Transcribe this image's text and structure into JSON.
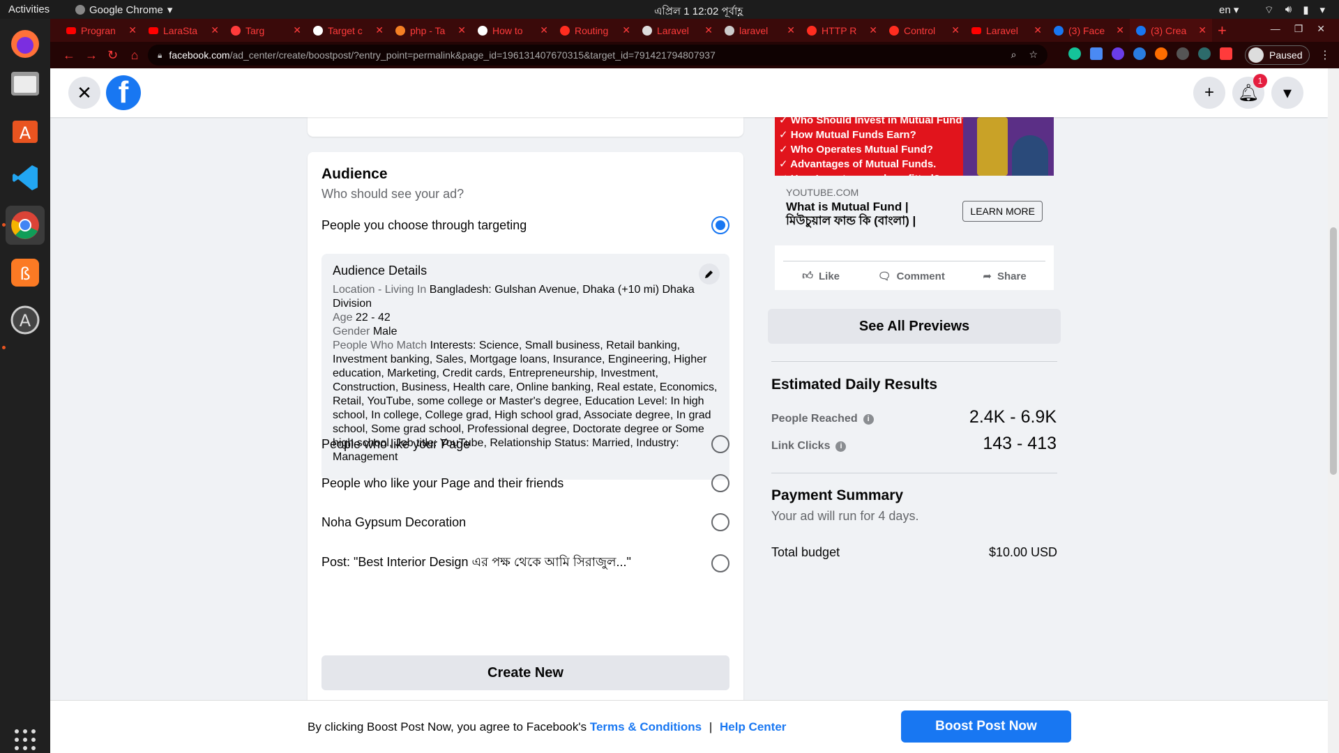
{
  "os": {
    "activities": "Activities",
    "app_name": "Google Chrome",
    "clock": "এপ্রিল 1  12:02 পূর্বাহ্ণ",
    "lang": "en"
  },
  "browser": {
    "tabs": [
      {
        "title": "Progran",
        "icon": "youtube-icon"
      },
      {
        "title": "LaraSta",
        "icon": "youtube-icon"
      },
      {
        "title": "Targ",
        "icon": "chrome-icon"
      },
      {
        "title": "Target c",
        "icon": "google-icon"
      },
      {
        "title": "php - Ta",
        "icon": "stackoverflow-icon"
      },
      {
        "title": "How to",
        "icon": "medium-icon"
      },
      {
        "title": "Routing",
        "icon": "laravel-icon"
      },
      {
        "title": "Laravel",
        "icon": "page-icon"
      },
      {
        "title": "laravel",
        "icon": "link-icon"
      },
      {
        "title": "HTTP R",
        "icon": "laravel-icon"
      },
      {
        "title": "Control",
        "icon": "laravel-icon"
      },
      {
        "title": "Laravel",
        "icon": "youtube-icon"
      },
      {
        "title": "(3) Face",
        "icon": "facebook-icon"
      },
      {
        "title": "(3) Crea",
        "icon": "facebook-icon"
      }
    ],
    "url_host": "facebook.com",
    "url_path": "/ad_center/create/boostpost/?entry_point=permalink&page_id=196131407670315&target_id=791421794807937",
    "profile_status": "Paused"
  },
  "header": {
    "notification_count": "1"
  },
  "audience": {
    "title": "Audience",
    "subtitle": "Who should see your ad?",
    "option_targeting": "People you choose through targeting",
    "details_title": "Audience Details",
    "location_label": "Location - Living In",
    "location_value": "Bangladesh: Gulshan Avenue, Dhaka (+10 mi) Dhaka Division",
    "age_label": "Age",
    "age_value": "22 - 42",
    "gender_label": "Gender",
    "gender_value": "Male",
    "match_label": "People Who Match",
    "match_value": "Interests: Science, Small business, Retail banking, Investment banking, Sales, Mortgage loans, Insurance, Engineering, Higher education, Marketing, Credit cards, Entrepreneurship, Investment, Construction, Business, Health care, Online banking, Real estate, Economics, Retail, YouTube, some college or Master's degree, Education Level: In high school, In college, College grad, High school grad, Associate degree, In grad school, Some grad school, Professional degree, Doctorate degree or Some high school, Job title: YouTube, Relationship Status: Married, Industry: Management",
    "option_like_page": "People who like your Page",
    "option_like_friends": "People who like your Page and their friends",
    "option_saved": "Noha Gypsum Decoration",
    "option_post": "Post: \"Best Interior Design এর পক্ষ থেকে আমি সিরাজুল...\"",
    "create_new": "Create New"
  },
  "preview": {
    "ad_lines": [
      "✓ Who Should Invest in Mutual Fund?",
      "✓ How Mutual Funds Earn?",
      "✓ Who Operates Mutual Fund?",
      "✓ Advantages of Mutual Funds.",
      "✓ How Investors are benefitted?"
    ],
    "domain": "YOUTUBE.COM",
    "headline": "What is Mutual Fund | মিউচুয়াল ফান্ড কি (বাংলা) |",
    "cta": "LEARN MORE",
    "like": "Like",
    "comment": "Comment",
    "share": "Share",
    "see_all": "See All Previews"
  },
  "results": {
    "title": "Estimated Daily Results",
    "people_reached_label": "People Reached",
    "people_reached_value": "2.4K - 6.9K",
    "link_clicks_label": "Link Clicks",
    "link_clicks_value": "143 - 413"
  },
  "payment": {
    "title": "Payment Summary",
    "duration": "Your ad will run for 4 days.",
    "budget_label": "Total budget",
    "budget_value": "$10.00 USD"
  },
  "footer": {
    "agree_text": "By clicking Boost Post Now, you agree to Facebook's",
    "terms": "Terms & Conditions",
    "separator": "|",
    "help": "Help Center",
    "boost": "Boost Post Now"
  },
  "colors": {
    "fb_blue": "#1877f2",
    "chrome_accent": "#ff3b3b",
    "ubuntu_orange": "#e95420"
  }
}
